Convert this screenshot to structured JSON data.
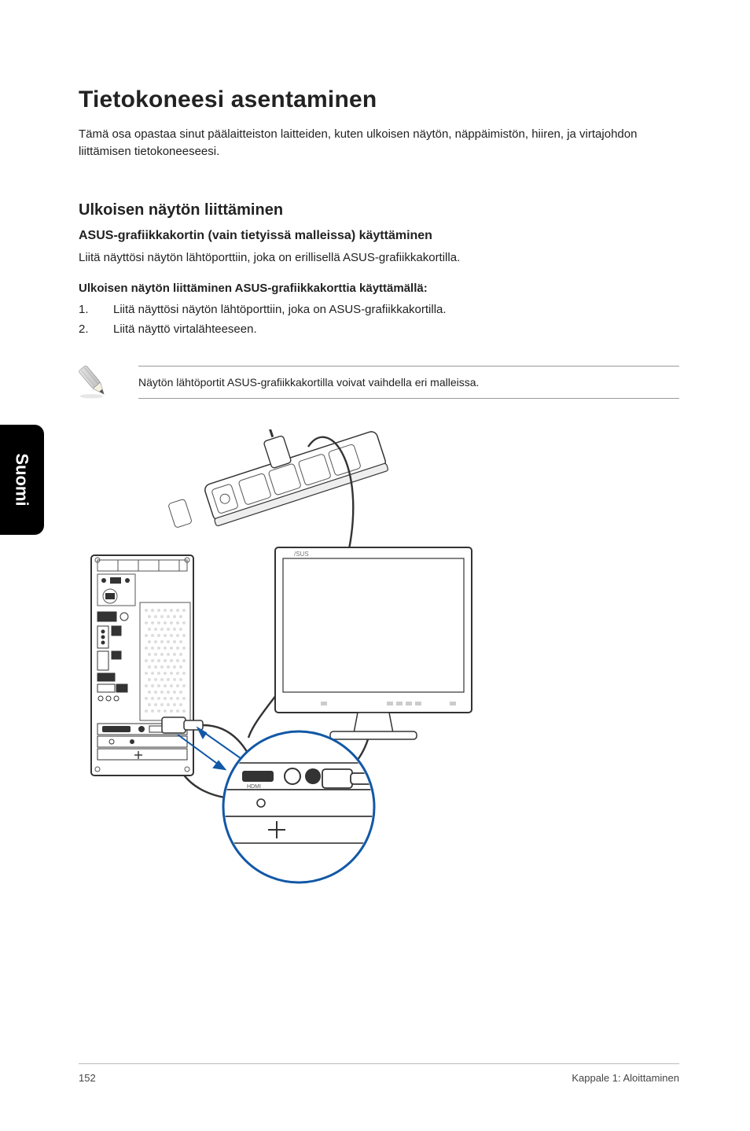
{
  "sideTab": "Suomi",
  "title": "Tietokoneesi asentaminen",
  "intro": "Tämä osa opastaa sinut päälaitteiston laitteiden, kuten ulkoisen näytön, näppäimistön, hiiren, ja virtajohdon liittämisen tietokoneeseesi.",
  "sectionH2": "Ulkoisen näytön liittäminen",
  "sectionH3": "ASUS-grafiikkakortin (vain tietyissä malleissa) käyttäminen",
  "sectionBody": "Liitä näyttösi näytön lähtöporttiin, joka on erillisellä ASUS-grafiikkakortilla.",
  "stepsHeading": "Ulkoisen näytön liittäminen ASUS-grafiikkakorttia käyttämällä:",
  "steps": [
    {
      "num": "1.",
      "text": "Liitä näyttösi näytön lähtöporttiin, joka on ASUS-grafiikkakortilla."
    },
    {
      "num": "2.",
      "text": "Liitä näyttö virtalähteeseen."
    }
  ],
  "noteText": "Näytön lähtöportit ASUS-grafiikkakortilla voivat vaihdella eri malleissa.",
  "footer": {
    "pageNum": "152",
    "chapter": "Kappale 1: Aloittaminen"
  }
}
